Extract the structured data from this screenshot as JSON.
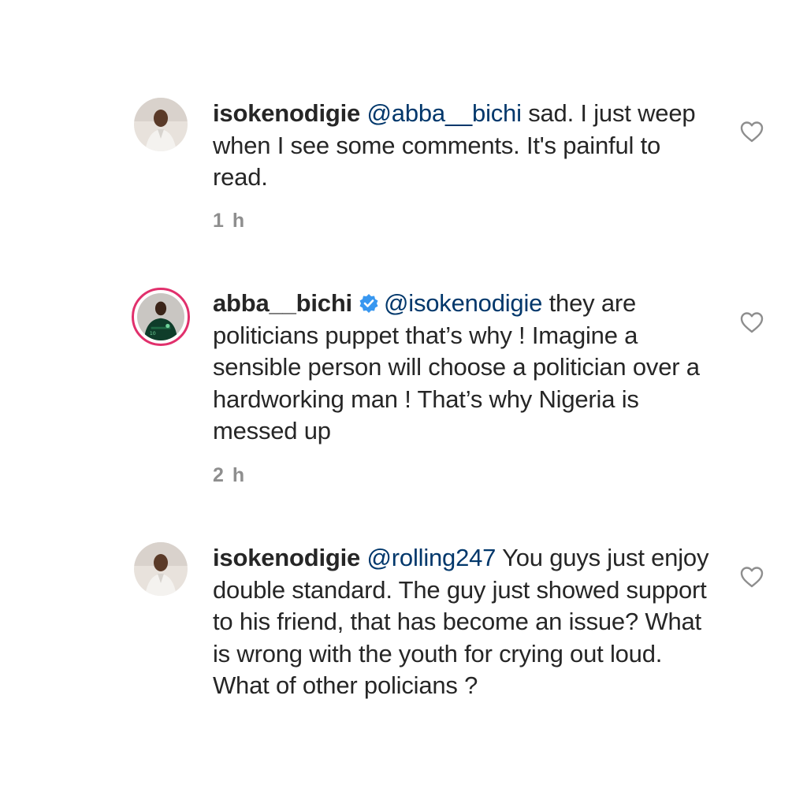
{
  "comments": [
    {
      "username": "isokenodigie",
      "verified": false,
      "mention": "@abba__bichi",
      "text": " sad. I just weep when I see some comments. It's painful to read.",
      "time": "1 h"
    },
    {
      "username": "abba__bichi",
      "verified": true,
      "mention": "@isokenodigie",
      "text": " they are politicians puppet that’s why ! Imagine a sensible person will choose a politician over a hardworking man ! That’s why Nigeria is messed up",
      "time": "2 h"
    },
    {
      "username": "isokenodigie",
      "verified": false,
      "mention": "@rolling247",
      "text": " You guys just enjoy double standard. The guy just showed support to his friend, that has become an issue? What is wrong with the youth for crying out loud. What of other policians ?",
      "time": ""
    }
  ],
  "icons": {
    "like": "heart-outline-icon",
    "verified": "verified-badge-icon"
  },
  "colors": {
    "mention": "#00376b",
    "verified": "#3897f0",
    "story_ring": "#e1306c",
    "meta": "#8e8e8e"
  }
}
